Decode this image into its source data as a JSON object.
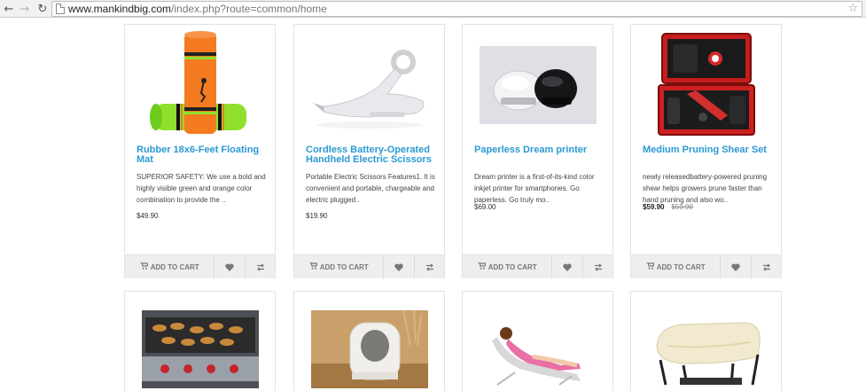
{
  "browser": {
    "url_host": "www.mankindbig.com",
    "url_path": "/index.php?route=common/home"
  },
  "cart_label": "ADD TO CART",
  "products_row1": [
    {
      "title": "Rubber 18x6-Feet Floating Mat",
      "description": "SUPERIOR SAFETY: We use a bold and highly visible green and orange color combination to provide the ..",
      "price": "$49.90"
    },
    {
      "title": "Cordless Battery-Operated Handheld Electric Scissors",
      "description": "Portable Electric Scissors Features1. It is convenient and portable, chargeable and electric plugged..",
      "price": "$19.90"
    },
    {
      "title": "Paperless Dream printer",
      "description": "Dream printer is a first-of-its-kind color inkjet printer for smartphones. Go paperless. Go truly mo..",
      "price": "$69.00"
    },
    {
      "title": "Medium Pruning Shear Set",
      "description": "newly releasedbattery-powered pruning shear helps growers prune faster than hand pruning and also wo..",
      "price_new": "$59.90",
      "price_old": "$59.90"
    }
  ],
  "products_row2_images": [
    "grill-image",
    "cat-litter-box-image",
    "lounge-chair-image",
    "air-mattress-image"
  ],
  "colors": {
    "title_link": "#2a9ad3",
    "button_bg": "#eeeeee",
    "border": "#e3e3e3"
  }
}
